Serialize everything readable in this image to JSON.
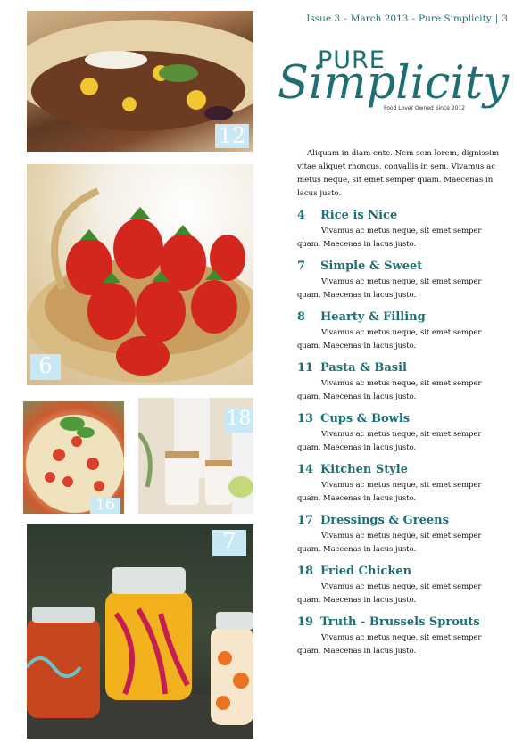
{
  "header": {
    "issue": "Issue 3",
    "date": "March 2013",
    "publication": "Pure Simplicity",
    "page_number": "3"
  },
  "brand": {
    "word1": "PURE",
    "word2": "Simplicity",
    "tagline": "Food Lover Owned Since 2012"
  },
  "intro": "Aliquam in diam ente. Nem sem lorem, dignissim vitae aliquet rhoncus, convallis in sem. Vivamus ac metus neque, sit emet semper quam. Maecenas in lacus justo.",
  "photos": [
    {
      "subject": "burrito",
      "page": "12"
    },
    {
      "subject": "strawberries-basket",
      "page": "6"
    },
    {
      "subject": "pasta-basil",
      "page": "16"
    },
    {
      "subject": "kitchen-jars",
      "page": "18"
    },
    {
      "subject": "jar-lanterns",
      "page": "7"
    }
  ],
  "toc": [
    {
      "page": "4",
      "title": "Rice is Nice",
      "desc": "Vivamus ac metus neque, sit emet semper quam. Maecenas in lacus justo."
    },
    {
      "page": "7",
      "title": "Simple & Sweet",
      "desc": "Vivamus ac metus neque, sit emet semper quam. Maecenas in lacus justo."
    },
    {
      "page": "8",
      "title": "Hearty & Filling",
      "desc": "Vivamus ac metus neque, sit emet semper quam. Maecenas in lacus justo."
    },
    {
      "page": "11",
      "title": "Pasta & Basil",
      "desc": "Vivamus ac metus neque, sit emet semper quam. Maecenas in lacus justo."
    },
    {
      "page": "13",
      "title": "Cups & Bowls",
      "desc": "Vivamus ac metus neque, sit emet semper quam. Maecenas in lacus justo."
    },
    {
      "page": "14",
      "title": "Kitchen Style",
      "desc": "Vivamus ac metus neque, sit emet semper quam. Maecenas in lacus justo."
    },
    {
      "page": "17",
      "title": "Dressings & Greens",
      "desc": "Vivamus ac metus neque, sit emet semper quam. Maecenas in lacus justo."
    },
    {
      "page": "18",
      "title": "Fried Chicken",
      "desc": "Vivamus ac metus neque, sit emet semper quam. Maecenas in lacus justo."
    },
    {
      "page": "19",
      "title": "Truth - Brussels Sprouts",
      "desc": "Vivamus ac metus neque, sit emet semper quam. Maecenas in lacus justo."
    }
  ],
  "colors": {
    "accent": "#1e6f73",
    "badge": "#c7e8f4"
  }
}
